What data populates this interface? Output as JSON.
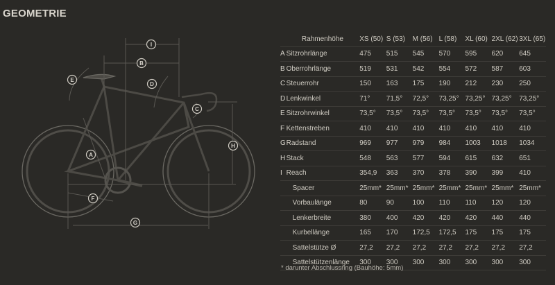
{
  "title": "GEOMETRIE",
  "diagram_labels": [
    "I",
    "B",
    "E",
    "D",
    "C",
    "H",
    "A",
    "F",
    "G"
  ],
  "table": {
    "header_label": "Rahmenhöhe",
    "sizes": [
      "XS (50)",
      "S (53)",
      "M (56)",
      "L (58)",
      "XL (60)",
      "2XL (62)",
      "3XL (65)"
    ],
    "rows": [
      {
        "letter": "A",
        "name": "Sitzrohrlänge",
        "values": [
          "475",
          "515",
          "545",
          "570",
          "595",
          "620",
          "645"
        ]
      },
      {
        "letter": "B",
        "name": "Oberrohrlänge",
        "values": [
          "519",
          "531",
          "542",
          "554",
          "572",
          "587",
          "603"
        ]
      },
      {
        "letter": "C",
        "name": "Steuerrohr",
        "values": [
          "150",
          "163",
          "175",
          "190",
          "212",
          "230",
          "250"
        ]
      },
      {
        "letter": "D",
        "name": "Lenkwinkel",
        "values": [
          "71°",
          "71,5°",
          "72,5°",
          "73,25°",
          "73,25°",
          "73,25°",
          "73,25°"
        ]
      },
      {
        "letter": "E",
        "name": "Sitzrohrwinkel",
        "values": [
          "73,5°",
          "73,5°",
          "73,5°",
          "73,5°",
          "73,5°",
          "73,5°",
          "73,5°"
        ]
      },
      {
        "letter": "F",
        "name": "Kettenstreben",
        "values": [
          "410",
          "410",
          "410",
          "410",
          "410",
          "410",
          "410"
        ]
      },
      {
        "letter": "G",
        "name": "Radstand",
        "values": [
          "969",
          "977",
          "979",
          "984",
          "1003",
          "1018",
          "1034"
        ]
      },
      {
        "letter": "H",
        "name": "Stack",
        "values": [
          "548",
          "563",
          "577",
          "594",
          "615",
          "632",
          "651"
        ]
      },
      {
        "letter": "I",
        "name": "Reach",
        "values": [
          "354,9",
          "363",
          "370",
          "378",
          "390",
          "399",
          "410"
        ]
      },
      {
        "letter": "",
        "name": "Spacer",
        "values": [
          "25mm*",
          "25mm*",
          "25mm*",
          "25mm*",
          "25mm*",
          "25mm*",
          "25mm*"
        ]
      },
      {
        "letter": "",
        "name": "Vorbaulänge",
        "values": [
          "80",
          "90",
          "100",
          "110",
          "110",
          "120",
          "120"
        ]
      },
      {
        "letter": "",
        "name": "Lenkerbreite",
        "values": [
          "380",
          "400",
          "420",
          "420",
          "420",
          "440",
          "440"
        ]
      },
      {
        "letter": "",
        "name": "Kurbellänge",
        "values": [
          "165",
          "170",
          "172,5",
          "172,5",
          "175",
          "175",
          "175"
        ]
      },
      {
        "letter": "",
        "name": "Sattelstütze Ø",
        "values": [
          "27,2",
          "27,2",
          "27,2",
          "27,2",
          "27,2",
          "27,2",
          "27,2"
        ]
      },
      {
        "letter": "",
        "name": "Sattelstützenlänge",
        "values": [
          "300",
          "300",
          "300",
          "300",
          "300",
          "300",
          "300"
        ]
      }
    ]
  },
  "footnote": "* darunter Abschlussring (Bauhöhe: 5mm)",
  "colors": {
    "background": "#2a2926",
    "text": "#cfcbc2",
    "line": "#5a5853",
    "frame": "#6b6963"
  }
}
